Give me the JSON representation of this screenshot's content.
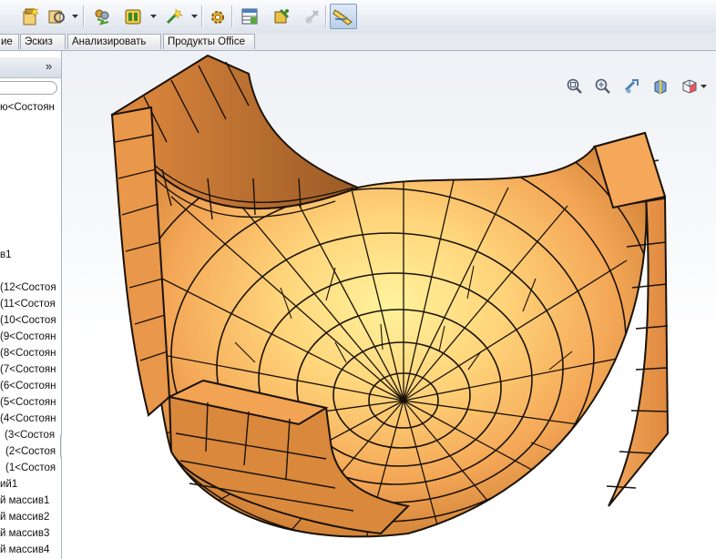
{
  "toolbar": {
    "icons": [
      "new-document-icon",
      "rebuild-icon",
      "options-icon",
      "select-component-icon",
      "assembly-tool-icon",
      "smart-fastener-icon",
      "settings-gear-icon",
      "bill-of-materials-icon",
      "configure-icon",
      "disabled-tool-icon",
      "measure-ruler-icon"
    ],
    "active": "measure-ruler-icon"
  },
  "tabs": [
    {
      "label": "ие"
    },
    {
      "label": "Эскиз"
    },
    {
      "label": "Анализировать"
    },
    {
      "label": "Продукты Office"
    }
  ],
  "sidebar": {
    "expand_label": "»",
    "items": [
      {
        "label": "ю<Состоян"
      },
      {
        "label": "в1"
      },
      {
        "label": "(12<Состоя"
      },
      {
        "label": "(11<Состоя"
      },
      {
        "label": "(10<Состоя"
      },
      {
        "label": "(9<Состоян"
      },
      {
        "label": "(8<Состоян"
      },
      {
        "label": "(7<Состоян"
      },
      {
        "label": "(6<Состоян"
      },
      {
        "label": "(5<Состоян"
      },
      {
        "label": "(4<Состоян"
      },
      {
        "label": "(3<Состоя"
      },
      {
        "label": "(2<Состоя"
      },
      {
        "label": "(1<Состоя"
      },
      {
        "label": "ий1"
      },
      {
        "label": "й массив1"
      },
      {
        "label": "й массив2"
      },
      {
        "label": "й массив3"
      },
      {
        "label": "й массив4"
      }
    ]
  },
  "viewport": {
    "headsup_icons": [
      "zoom-to-fit-icon",
      "zoom-to-area-icon",
      "previous-view-icon",
      "section-view-icon",
      "view-orientation-icon"
    ],
    "colors": {
      "brick_light": "#fff09a",
      "brick_mid": "#f7b866",
      "brick_dark": "#b86a2c",
      "mortar": "#1a1208"
    }
  }
}
